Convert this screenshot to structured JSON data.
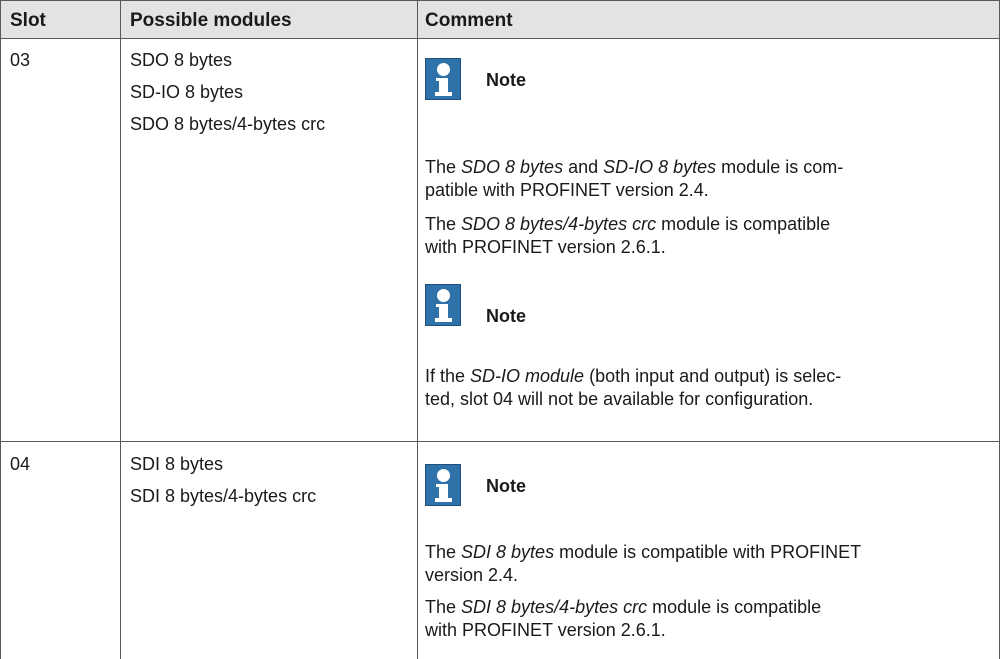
{
  "table": {
    "headers": {
      "slot": "Slot",
      "modules": "Possible modules",
      "comment": "Comment"
    },
    "rows": [
      {
        "slot": "03",
        "modules": [
          "SDO 8 bytes",
          "SD-IO 8 bytes",
          "SDO 8 bytes/4-bytes crc"
        ],
        "notes": [
          {
            "label": "Note",
            "paragraphs": [
              {
                "pre": "The ",
                "em": "SDO 8 bytes",
                "mid": " and ",
                "em2": "SD-IO 8 bytes",
                "line1_post": " module is com-",
                "line2": "patible with PROFINET version 2.4."
              },
              {
                "pre": "The ",
                "em": "SDO 8 bytes/4-bytes crc",
                "line1_post": " module is compatible",
                "line2": "with PROFINET version 2.6.1."
              }
            ]
          },
          {
            "label": "Note",
            "paragraphs": [
              {
                "pre": "If the ",
                "em": "SD-IO module",
                "line1_post": " (both input and output) is selec-",
                "line2": "ted, slot 04 will not be available for configuration."
              }
            ]
          }
        ]
      },
      {
        "slot": "04",
        "modules": [
          "SDI 8 bytes",
          "SDI 8 bytes/4-bytes crc"
        ],
        "notes": [
          {
            "label": "Note",
            "paragraphs": [
              {
                "pre": "The ",
                "em": "SDI 8 bytes",
                "line1_post": " module is compatible with PROFINET",
                "line2": "version 2.4."
              },
              {
                "pre": "The ",
                "em": "SDI 8 bytes/4-bytes crc",
                "line1_post": " module is compatible",
                "line2": "with PROFINET version 2.6.1."
              }
            ]
          }
        ]
      }
    ]
  }
}
